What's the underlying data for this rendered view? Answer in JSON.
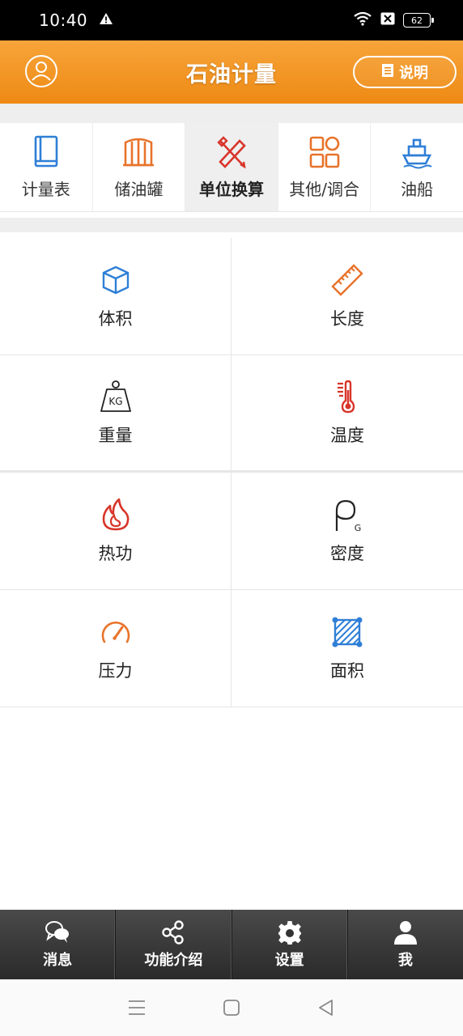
{
  "status": {
    "time": "10:40",
    "battery": "62"
  },
  "header": {
    "title": "石油计量",
    "help_label": "说明"
  },
  "tabs": [
    {
      "label": "计量表",
      "icon": "book-icon"
    },
    {
      "label": "储油罐",
      "icon": "tank-icon"
    },
    {
      "label": "单位换算",
      "icon": "ruler-pencil-icon",
      "active": true
    },
    {
      "label": "其他/调合",
      "icon": "grid-icon"
    },
    {
      "label": "油船",
      "icon": "ship-icon"
    }
  ],
  "units": [
    {
      "label": "体积",
      "icon": "cube-icon"
    },
    {
      "label": "长度",
      "icon": "ruler-icon"
    },
    {
      "label": "重量",
      "icon": "weight-icon"
    },
    {
      "label": "温度",
      "icon": "thermometer-icon"
    },
    {
      "label": "热功",
      "icon": "flame-icon"
    },
    {
      "label": "密度",
      "icon": "density-icon",
      "symbol": "G"
    },
    {
      "label": "压力",
      "icon": "gauge-icon"
    },
    {
      "label": "面积",
      "icon": "area-icon"
    }
  ],
  "weight_text": "KG",
  "bottom_nav": [
    {
      "label": "消息",
      "icon": "chat-icon"
    },
    {
      "label": "功能介绍",
      "icon": "share-icon"
    },
    {
      "label": "设置",
      "icon": "gear-icon"
    },
    {
      "label": "我",
      "icon": "user-icon"
    }
  ],
  "colors": {
    "accent": "#f08c16",
    "blue": "#2f7fd6",
    "orange": "#e8732a",
    "red": "#d8352a"
  }
}
